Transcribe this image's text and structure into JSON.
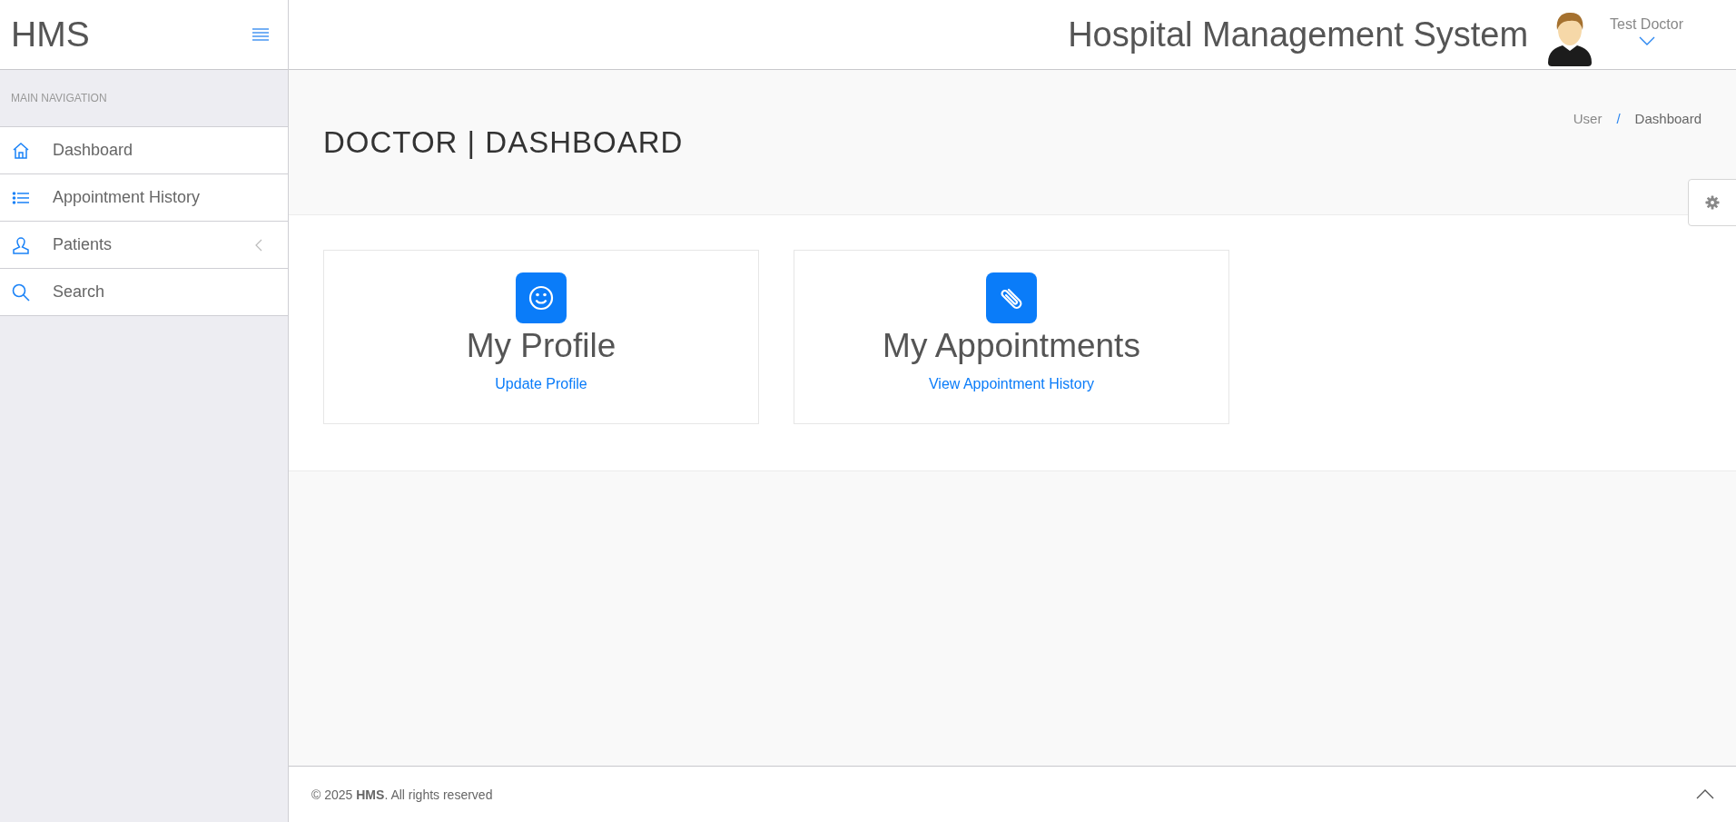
{
  "brand": {
    "logo": "HMS"
  },
  "header": {
    "title": "Hospital Management System",
    "user_name": "Test Doctor"
  },
  "sidebar": {
    "section_label": "MAIN NAVIGATION",
    "items": [
      {
        "label": "Dashboard",
        "kind": "home",
        "has_submenu": false
      },
      {
        "label": "Appointment History",
        "kind": "list",
        "has_submenu": false
      },
      {
        "label": "Patients",
        "kind": "user",
        "has_submenu": true
      },
      {
        "label": "Search",
        "kind": "search",
        "has_submenu": false
      }
    ]
  },
  "page": {
    "title": "DOCTOR | DASHBOARD",
    "breadcrumb": [
      "User",
      "Dashboard"
    ],
    "breadcrumb_separator": "/"
  },
  "cards": [
    {
      "kind": "smile",
      "title": "My Profile",
      "link": "Update Profile"
    },
    {
      "kind": "paperclip",
      "title": "My Appointments",
      "link": "View Appointment History"
    }
  ],
  "footer": {
    "text": "© 2025 **HMS**. All rights reserved"
  }
}
